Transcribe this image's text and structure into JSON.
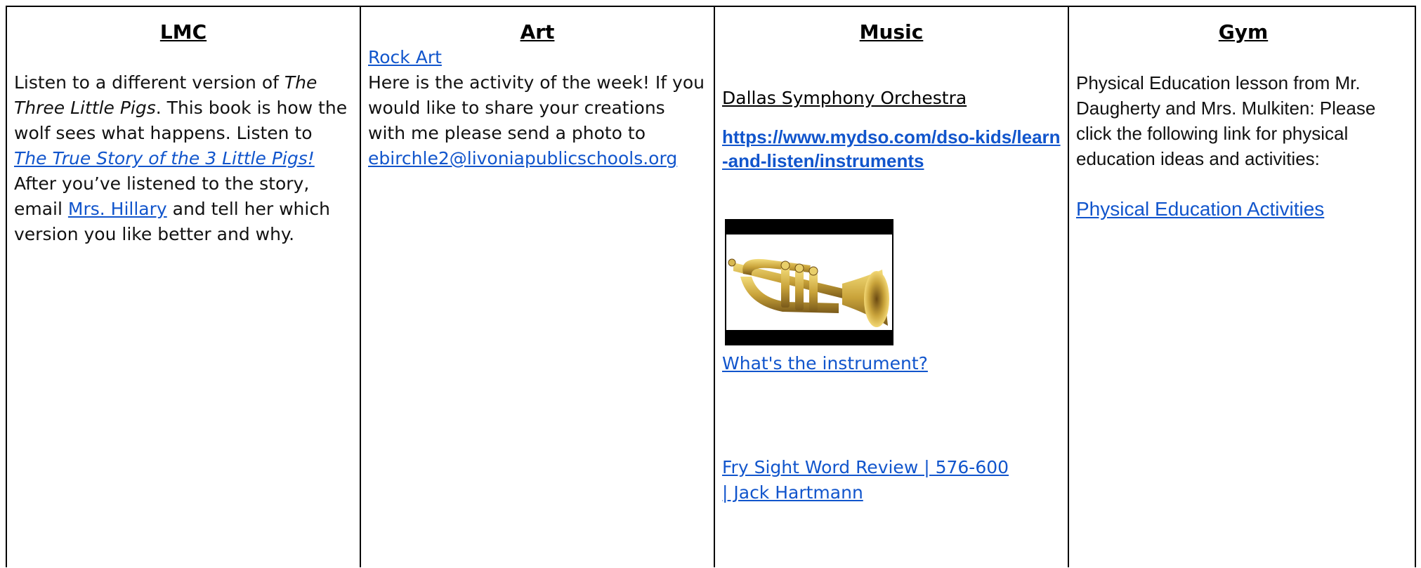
{
  "columns": {
    "lmc": {
      "heading": "LMC",
      "t1": "Listen to a different version of ",
      "t2": "The Three Little Pigs",
      "t3": ".  This book is how the wolf sees what happens.  Listen to ",
      "link_story": "The True Story of the 3 Little Pigs!",
      "t4": "After you’ve listened to the story, email ",
      "link_email": "Mrs. Hillary",
      "t5": " and tell her which version you like better and why."
    },
    "art": {
      "heading": "Art",
      "link_rock": "Rock Art",
      "body": "Here is the activity of the week! If you would like to share your creations with me please send a photo to",
      "email": "ebirchle2@livoniapublicschools.org"
    },
    "music": {
      "heading": "Music",
      "orchestra": "Dallas Symphony Orchestra",
      "url": "https://www.mydso.com/dso-kids/learn-and-listen/instruments",
      "link_instrument": "What's the instrument?",
      "link_fry": "Fry Sight Word Review | 576-600 | Jack Hartmann"
    },
    "gym": {
      "heading": "Gym",
      "body": "Physical Education lesson from Mr. Daugherty and Mrs. Mulkiten: Please click the following link for physical education ideas and activities:",
      "link_pe": "Physical Education Activities"
    }
  }
}
